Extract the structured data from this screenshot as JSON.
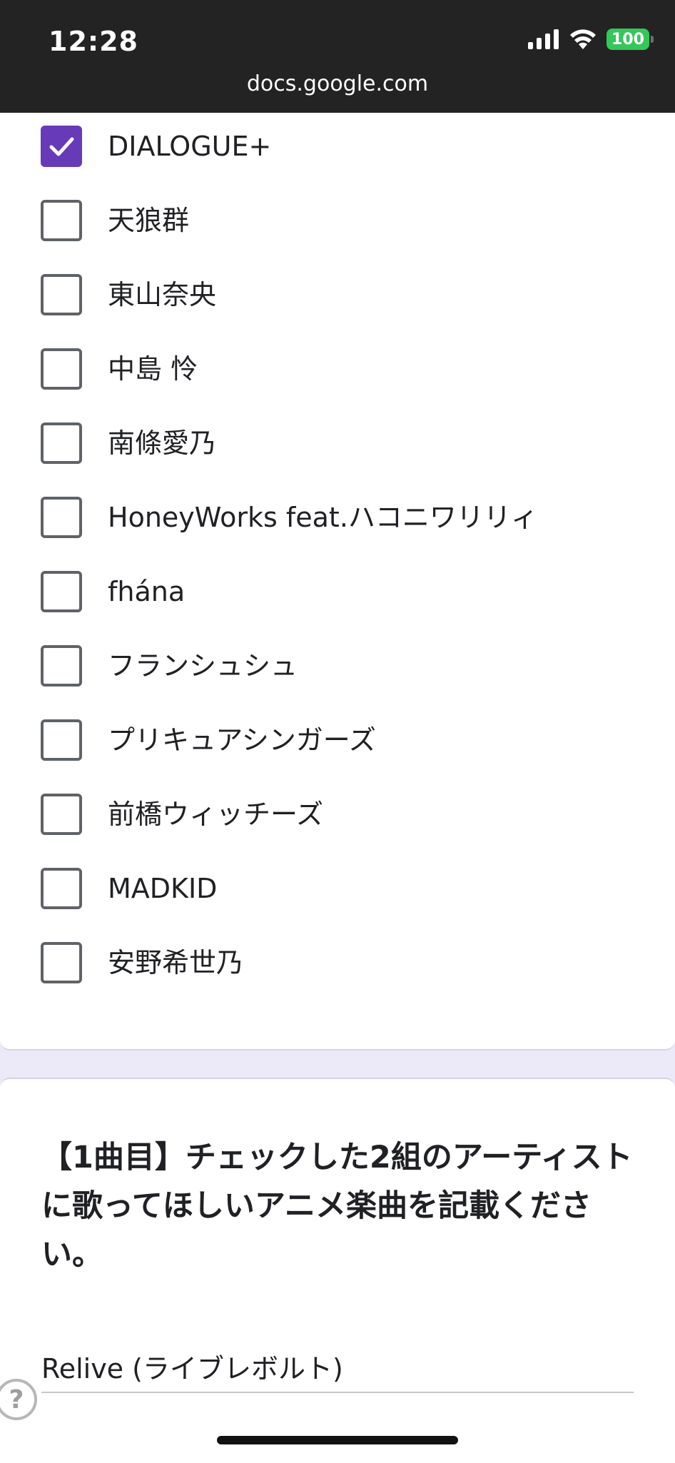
{
  "status_bar": {
    "time": "12:28",
    "battery": "100",
    "url": "docs.google.com",
    "icons": [
      "signal-icon",
      "wifi-icon",
      "battery-icon"
    ]
  },
  "options": [
    {
      "label": "DIALOGUE+",
      "checked": true
    },
    {
      "label": "天狼群",
      "checked": false
    },
    {
      "label": "東山奈央",
      "checked": false
    },
    {
      "label": "中島 怜",
      "checked": false
    },
    {
      "label": "南條愛乃",
      "checked": false
    },
    {
      "label": "HoneyWorks feat.ハコニワリリィ",
      "checked": false
    },
    {
      "label": "fhána",
      "checked": false
    },
    {
      "label": "フランシュシュ",
      "checked": false
    },
    {
      "label": "プリキュアシンガーズ",
      "checked": false
    },
    {
      "label": "前橋ウィッチーズ",
      "checked": false
    },
    {
      "label": "MADKID",
      "checked": false
    },
    {
      "label": "安野希世乃",
      "checked": false
    }
  ],
  "question": {
    "title": "【1曲目】チェックした2組のアーティストに歌ってほしいアニメ楽曲を記載ください。",
    "answer": "Relive (ライブレボルト)"
  },
  "help_icon": "?",
  "colors": {
    "accent": "#673ab7",
    "status_bar_bg": "#232323",
    "page_bg": "#ece9f8"
  }
}
